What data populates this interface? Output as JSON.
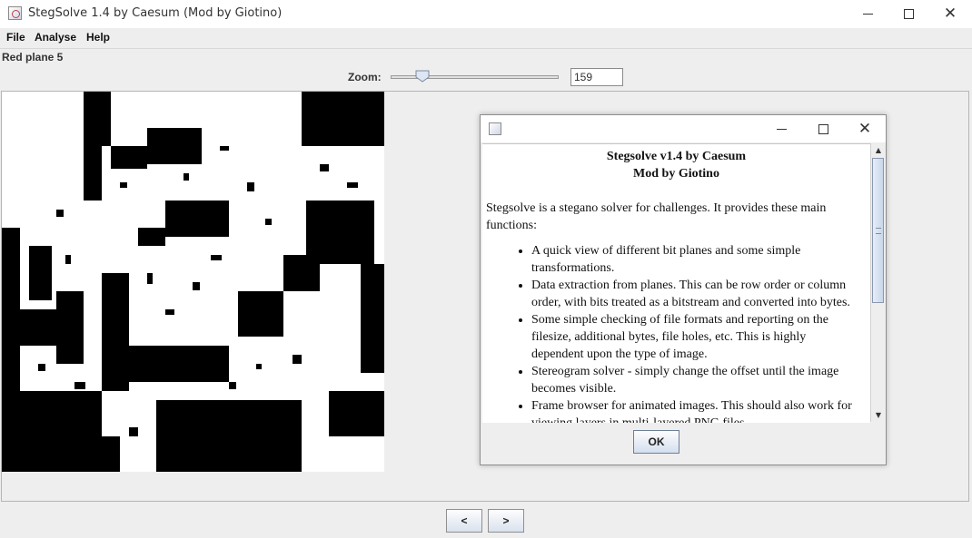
{
  "window": {
    "title": "StegSolve 1.4 by Caesum (Mod by Giotino)",
    "controls": {
      "minimize": "—",
      "maximize": "☐",
      "close": "✕"
    }
  },
  "menu": {
    "items": [
      "File",
      "Analyse",
      "Help"
    ]
  },
  "plane_label": "Red plane 5",
  "zoom": {
    "label": "Zoom:",
    "value": "159",
    "slider_fraction": 0.16
  },
  "image": {
    "icon": "bit-plane-image",
    "colors": {
      "dark": "#000000",
      "light": "#ffffff"
    }
  },
  "nav": {
    "prev": "<",
    "next": ">"
  },
  "dialog": {
    "title_1": "Stegsolve v1.4 by Caesum",
    "title_2": "Mod by Giotino",
    "intro": "Stegsolve is a stegano solver for challenges. It provides these main functions:",
    "items": [
      "A quick view of different bit planes and some simple transformations.",
      "Data extraction from planes. This can be row order or column order, with bits treated as a bitstream and converted into bytes.",
      "Some simple checking of file formats and reporting on the filesize, additional bytes, file holes, etc. This is highly dependent upon the type of image.",
      "Stereogram solver - simply change the offset until the image becomes visible.",
      "Frame browser for animated images. This should also work for viewing layers in multi-layered PNG files."
    ],
    "ok": "OK"
  },
  "colors": {
    "accent": "#c8d6ea",
    "background": "#eeeeee"
  }
}
